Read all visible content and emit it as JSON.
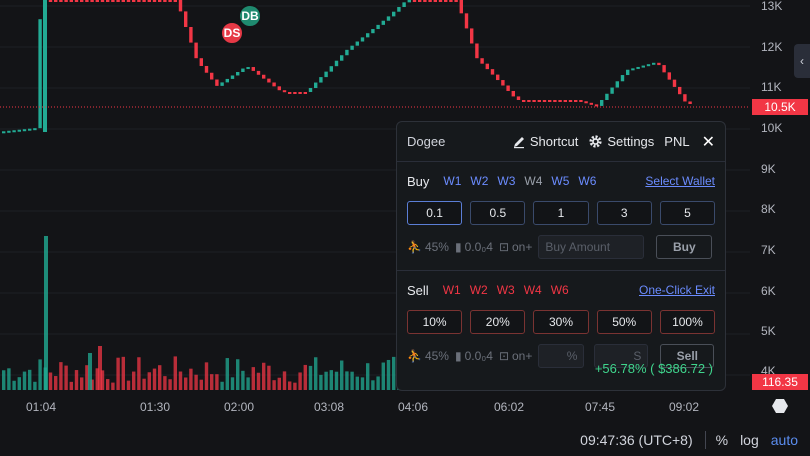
{
  "markers": {
    "ds": "DS",
    "db": "DB"
  },
  "price_axis": {
    "labels": [
      "13K",
      "12K",
      "11K",
      "10K",
      "9K",
      "8K",
      "7K",
      "6K",
      "5K",
      "4K"
    ],
    "current_price": "10.5K",
    "volume_tag": "116.35",
    "collapse_icon": "chevron-left-icon"
  },
  "time_axis": {
    "labels": [
      "01:04",
      "01:30",
      "02:00",
      "03:08",
      "04:06",
      "06:02",
      "07:45",
      "09:02"
    ]
  },
  "bottom_bar": {
    "clock": "09:47:36 (UTC+8)",
    "percent": "%",
    "log": "log",
    "auto": "auto"
  },
  "panel": {
    "token": "Dogee",
    "shortcut": "Shortcut",
    "settings": "Settings",
    "pnl_label": "PNL",
    "buy": {
      "label": "Buy",
      "wallets": [
        "W1",
        "W2",
        "W3",
        "W4",
        "W5",
        "W6"
      ],
      "select_wallet": "Select Wallet",
      "amounts": [
        "0.1",
        "0.5",
        "1",
        "3",
        "5"
      ],
      "slippage": "45%",
      "gas": "0.0₀4",
      "mev": "on+",
      "amount_placeholder": "Buy Amount",
      "action": "Buy"
    },
    "sell": {
      "label": "Sell",
      "wallets": [
        "W1",
        "W2",
        "W3",
        "W4",
        "W6"
      ],
      "one_click": "One-Click Exit",
      "percents": [
        "10%",
        "20%",
        "30%",
        "50%",
        "100%"
      ],
      "slippage": "45%",
      "gas": "0.0₀4",
      "mev": "on+",
      "pct_placeholder": "%",
      "amt_placeholder": "S",
      "action": "Sell"
    },
    "pnl_value": "+56.78% ( $386.72 )"
  },
  "colors": {
    "up": "#22ab94",
    "down": "#f23645",
    "accent": "#5b8def"
  }
}
